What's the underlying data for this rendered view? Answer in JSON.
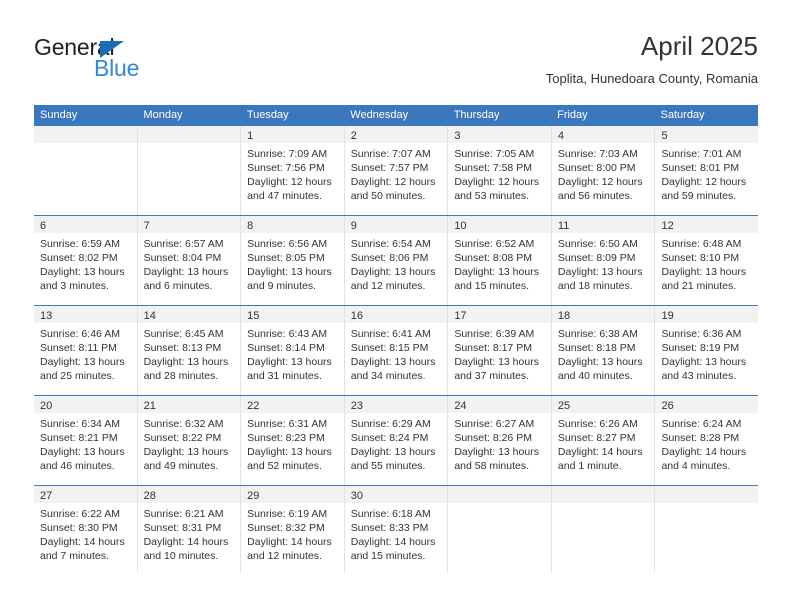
{
  "brand": {
    "name_part1": "General",
    "name_part2": "Blue",
    "triangle_color": "#1a6cb5",
    "blue_text_color": "#2e8ad6"
  },
  "header": {
    "title": "April 2025",
    "subtitle": "Toplita, Hunedoara County, Romania"
  },
  "theme": {
    "header_row_bg": "#3b77bd",
    "header_row_text": "#ffffff",
    "daynum_band_bg": "#f2f2f2",
    "cell_border": "#e2e2e2",
    "text": "#333333"
  },
  "weekdays": [
    "Sunday",
    "Monday",
    "Tuesday",
    "Wednesday",
    "Thursday",
    "Friday",
    "Saturday"
  ],
  "weeks": [
    [
      {
        "day": "",
        "sunrise": "",
        "sunset": "",
        "daylight": ""
      },
      {
        "day": "",
        "sunrise": "",
        "sunset": "",
        "daylight": ""
      },
      {
        "day": "1",
        "sunrise": "Sunrise: 7:09 AM",
        "sunset": "Sunset: 7:56 PM",
        "daylight": "Daylight: 12 hours and 47 minutes."
      },
      {
        "day": "2",
        "sunrise": "Sunrise: 7:07 AM",
        "sunset": "Sunset: 7:57 PM",
        "daylight": "Daylight: 12 hours and 50 minutes."
      },
      {
        "day": "3",
        "sunrise": "Sunrise: 7:05 AM",
        "sunset": "Sunset: 7:58 PM",
        "daylight": "Daylight: 12 hours and 53 minutes."
      },
      {
        "day": "4",
        "sunrise": "Sunrise: 7:03 AM",
        "sunset": "Sunset: 8:00 PM",
        "daylight": "Daylight: 12 hours and 56 minutes."
      },
      {
        "day": "5",
        "sunrise": "Sunrise: 7:01 AM",
        "sunset": "Sunset: 8:01 PM",
        "daylight": "Daylight: 12 hours and 59 minutes."
      }
    ],
    [
      {
        "day": "6",
        "sunrise": "Sunrise: 6:59 AM",
        "sunset": "Sunset: 8:02 PM",
        "daylight": "Daylight: 13 hours and 3 minutes."
      },
      {
        "day": "7",
        "sunrise": "Sunrise: 6:57 AM",
        "sunset": "Sunset: 8:04 PM",
        "daylight": "Daylight: 13 hours and 6 minutes."
      },
      {
        "day": "8",
        "sunrise": "Sunrise: 6:56 AM",
        "sunset": "Sunset: 8:05 PM",
        "daylight": "Daylight: 13 hours and 9 minutes."
      },
      {
        "day": "9",
        "sunrise": "Sunrise: 6:54 AM",
        "sunset": "Sunset: 8:06 PM",
        "daylight": "Daylight: 13 hours and 12 minutes."
      },
      {
        "day": "10",
        "sunrise": "Sunrise: 6:52 AM",
        "sunset": "Sunset: 8:08 PM",
        "daylight": "Daylight: 13 hours and 15 minutes."
      },
      {
        "day": "11",
        "sunrise": "Sunrise: 6:50 AM",
        "sunset": "Sunset: 8:09 PM",
        "daylight": "Daylight: 13 hours and 18 minutes."
      },
      {
        "day": "12",
        "sunrise": "Sunrise: 6:48 AM",
        "sunset": "Sunset: 8:10 PM",
        "daylight": "Daylight: 13 hours and 21 minutes."
      }
    ],
    [
      {
        "day": "13",
        "sunrise": "Sunrise: 6:46 AM",
        "sunset": "Sunset: 8:11 PM",
        "daylight": "Daylight: 13 hours and 25 minutes."
      },
      {
        "day": "14",
        "sunrise": "Sunrise: 6:45 AM",
        "sunset": "Sunset: 8:13 PM",
        "daylight": "Daylight: 13 hours and 28 minutes."
      },
      {
        "day": "15",
        "sunrise": "Sunrise: 6:43 AM",
        "sunset": "Sunset: 8:14 PM",
        "daylight": "Daylight: 13 hours and 31 minutes."
      },
      {
        "day": "16",
        "sunrise": "Sunrise: 6:41 AM",
        "sunset": "Sunset: 8:15 PM",
        "daylight": "Daylight: 13 hours and 34 minutes."
      },
      {
        "day": "17",
        "sunrise": "Sunrise: 6:39 AM",
        "sunset": "Sunset: 8:17 PM",
        "daylight": "Daylight: 13 hours and 37 minutes."
      },
      {
        "day": "18",
        "sunrise": "Sunrise: 6:38 AM",
        "sunset": "Sunset: 8:18 PM",
        "daylight": "Daylight: 13 hours and 40 minutes."
      },
      {
        "day": "19",
        "sunrise": "Sunrise: 6:36 AM",
        "sunset": "Sunset: 8:19 PM",
        "daylight": "Daylight: 13 hours and 43 minutes."
      }
    ],
    [
      {
        "day": "20",
        "sunrise": "Sunrise: 6:34 AM",
        "sunset": "Sunset: 8:21 PM",
        "daylight": "Daylight: 13 hours and 46 minutes."
      },
      {
        "day": "21",
        "sunrise": "Sunrise: 6:32 AM",
        "sunset": "Sunset: 8:22 PM",
        "daylight": "Daylight: 13 hours and 49 minutes."
      },
      {
        "day": "22",
        "sunrise": "Sunrise: 6:31 AM",
        "sunset": "Sunset: 8:23 PM",
        "daylight": "Daylight: 13 hours and 52 minutes."
      },
      {
        "day": "23",
        "sunrise": "Sunrise: 6:29 AM",
        "sunset": "Sunset: 8:24 PM",
        "daylight": "Daylight: 13 hours and 55 minutes."
      },
      {
        "day": "24",
        "sunrise": "Sunrise: 6:27 AM",
        "sunset": "Sunset: 8:26 PM",
        "daylight": "Daylight: 13 hours and 58 minutes."
      },
      {
        "day": "25",
        "sunrise": "Sunrise: 6:26 AM",
        "sunset": "Sunset: 8:27 PM",
        "daylight": "Daylight: 14 hours and 1 minute."
      },
      {
        "day": "26",
        "sunrise": "Sunrise: 6:24 AM",
        "sunset": "Sunset: 8:28 PM",
        "daylight": "Daylight: 14 hours and 4 minutes."
      }
    ],
    [
      {
        "day": "27",
        "sunrise": "Sunrise: 6:22 AM",
        "sunset": "Sunset: 8:30 PM",
        "daylight": "Daylight: 14 hours and 7 minutes."
      },
      {
        "day": "28",
        "sunrise": "Sunrise: 6:21 AM",
        "sunset": "Sunset: 8:31 PM",
        "daylight": "Daylight: 14 hours and 10 minutes."
      },
      {
        "day": "29",
        "sunrise": "Sunrise: 6:19 AM",
        "sunset": "Sunset: 8:32 PM",
        "daylight": "Daylight: 14 hours and 12 minutes."
      },
      {
        "day": "30",
        "sunrise": "Sunrise: 6:18 AM",
        "sunset": "Sunset: 8:33 PM",
        "daylight": "Daylight: 14 hours and 15 minutes."
      },
      {
        "day": "",
        "sunrise": "",
        "sunset": "",
        "daylight": ""
      },
      {
        "day": "",
        "sunrise": "",
        "sunset": "",
        "daylight": ""
      },
      {
        "day": "",
        "sunrise": "",
        "sunset": "",
        "daylight": ""
      }
    ]
  ]
}
